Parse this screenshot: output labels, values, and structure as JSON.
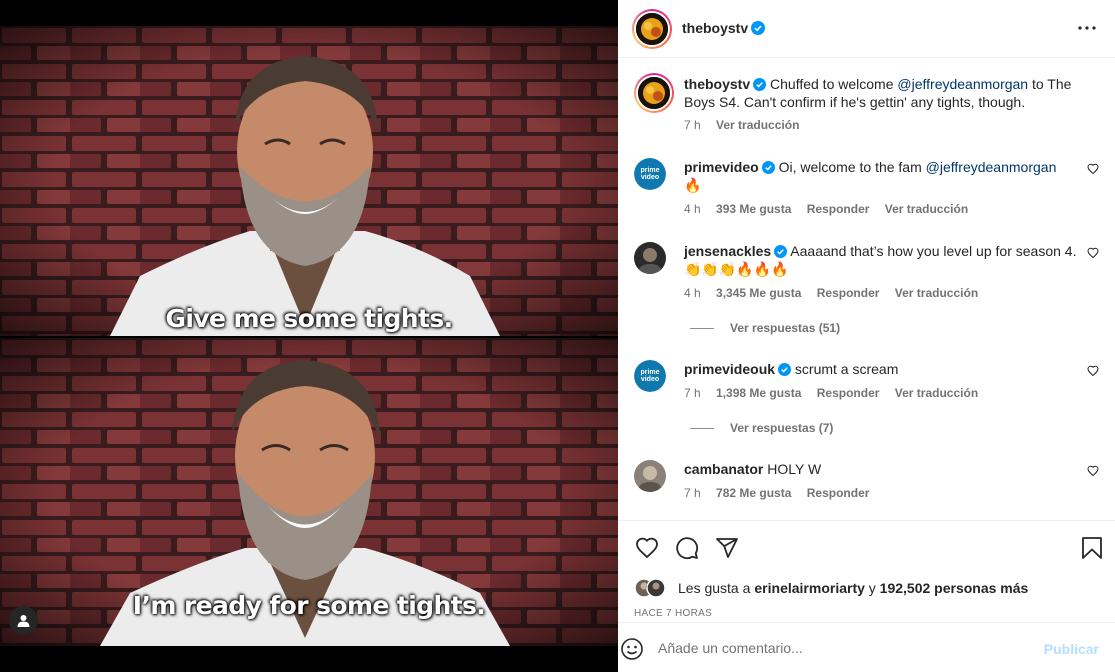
{
  "media": {
    "caption_top": "Give me some tights.",
    "caption_bottom": "I’m ready for some tights."
  },
  "header": {
    "username": "theboystv"
  },
  "post": {
    "username": "theboystv",
    "text_before": "Chuffed to welcome ",
    "mention": "@jeffreydeanmorgan",
    "text_after": " to The Boys S4. Can't confirm if he's gettin' any tights, though.",
    "time": "7 h",
    "translate": "Ver traducción"
  },
  "comments": [
    {
      "username": "primevideo",
      "text": "Oi, welcome to the fam ",
      "mention": "@jeffreydeanmorgan",
      "emoji": "🔥",
      "time": "4 h",
      "likes": "393 Me gusta",
      "reply": "Responder",
      "translate": "Ver traducción",
      "avatar_text_1": "prime",
      "avatar_text_2": "video"
    },
    {
      "username": "jensenackles",
      "text": "Aaaaand that’s how you level up for season 4. 👏👏👏🔥🔥🔥",
      "time": "4 h",
      "likes": "3,345 Me gusta",
      "reply": "Responder",
      "translate": "Ver traducción",
      "replies": "Ver respuestas (51)"
    },
    {
      "username": "primevideouk",
      "text": "scrumt a scream",
      "time": "7 h",
      "likes": "1,398 Me gusta",
      "reply": "Responder",
      "translate": "Ver traducción",
      "replies": "Ver respuestas (7)",
      "avatar_text_1": "prime",
      "avatar_text_2": "video"
    },
    {
      "username": "cambanator",
      "text": "HOLY W",
      "time": "7 h",
      "likes": "782 Me gusta",
      "reply": "Responder"
    }
  ],
  "likes": {
    "prefix": "Les gusta a ",
    "user": "erinelairmoriarty",
    "middle": " y ",
    "count": "192,502 personas más"
  },
  "timestamp": "HACE 7 HORAS",
  "add_comment": {
    "placeholder": "Añade un comentario...",
    "publish": "Publicar"
  },
  "colors": {
    "verified": "#0095f6",
    "mention": "#00376b",
    "muted": "#737373",
    "publish": "#b2dffc"
  }
}
